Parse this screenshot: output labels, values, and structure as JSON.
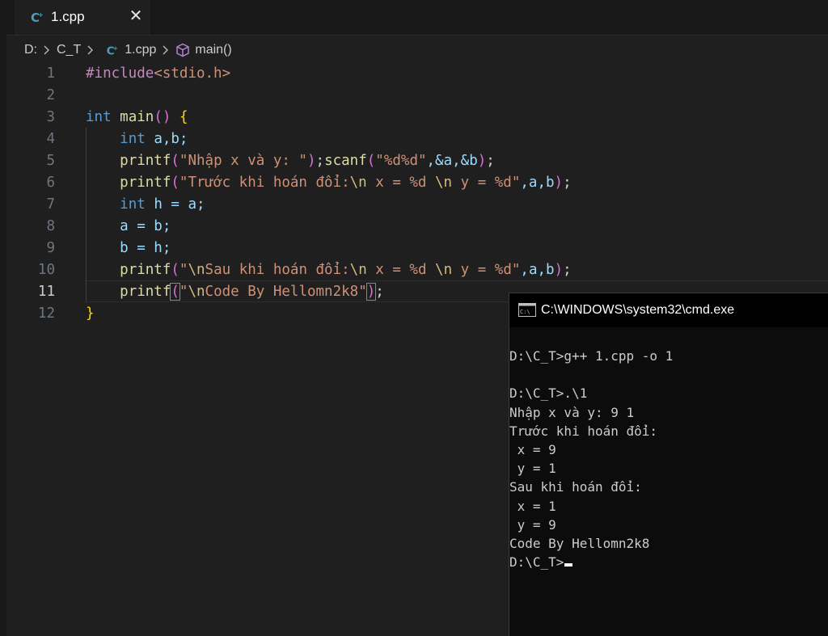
{
  "tab": {
    "filename": "1.cpp",
    "close_glyph": "✕"
  },
  "breadcrumb": {
    "drive": "D:",
    "folder": "C_T",
    "file": "1.cpp",
    "symbol": "main()"
  },
  "editor": {
    "active_line": 11,
    "lines": [
      {
        "number": "1"
      },
      {
        "number": "2"
      },
      {
        "number": "3"
      },
      {
        "number": "4"
      },
      {
        "number": "5"
      },
      {
        "number": "6"
      },
      {
        "number": "7"
      },
      {
        "number": "8"
      },
      {
        "number": "9"
      },
      {
        "number": "10"
      },
      {
        "number": "11"
      },
      {
        "number": "12"
      }
    ],
    "code": {
      "l1_pre": "#include",
      "l1_inc": "<stdio.h>",
      "l3_type": "int",
      "l3_fn": "main",
      "l4_type": "int",
      "l4_vars": "a,b;",
      "l5_fn1": "printf",
      "l5_str1": "\"Nhập x và y: \"",
      "l5_fn2": "scanf",
      "l5_str2": "\"%d%d\"",
      "l5_args": ",&a,&b",
      "l6_fn": "printf",
      "l6_str_a": "\"Trước khi hoán đổi:",
      "l6_esc1": "\\n",
      "l6_str_b": " x = %d ",
      "l6_esc2": "\\n",
      "l6_str_c": " y = %d\"",
      "l6_args": ",a,b",
      "l7_type": "int",
      "l7_rest": "h = a;",
      "l8": "a = b;",
      "l9": "b = h;",
      "l10_fn": "printf",
      "l10_str_a": "\"",
      "l10_esc1": "\\n",
      "l10_str_b": "Sau khi hoán đổi:",
      "l10_esc2": "\\n",
      "l10_str_c": " x = %d ",
      "l10_esc3": "\\n",
      "l10_str_d": " y = %d\"",
      "l10_args": ",a,b",
      "l11_fn": "printf",
      "l11_str_a": "\"",
      "l11_esc": "\\n",
      "l11_str_b": "Code By Hellomn2k8\""
    }
  },
  "cmd": {
    "title": "C:\\WINDOWS\\system32\\cmd.exe",
    "lines": [
      "D:\\C_T>g++ 1.cpp -o 1",
      "",
      "D:\\C_T>.\\1",
      "Nhập x và y: 9 1",
      "Trước khi hoán đổi:",
      " x = 9",
      " y = 1",
      "Sau khi hoán đổi:",
      " x = 1",
      " y = 9",
      "Code By Hellomn2k8",
      "D:\\C_T>"
    ]
  },
  "colors": {
    "editor_bg": "#1f1f1f",
    "tabbar_bg": "#181818",
    "cmd_bg": "#0c0c0c",
    "cpp_icon": "#519aba",
    "symbol_icon": "#b180d7"
  },
  "icons": {
    "tab": "cpp-file-icon",
    "close": "close-icon",
    "breadcrumb_file": "cpp-file-icon",
    "breadcrumb_symbol": "cube-symbol-icon",
    "cmd": "cmd-console-icon"
  }
}
